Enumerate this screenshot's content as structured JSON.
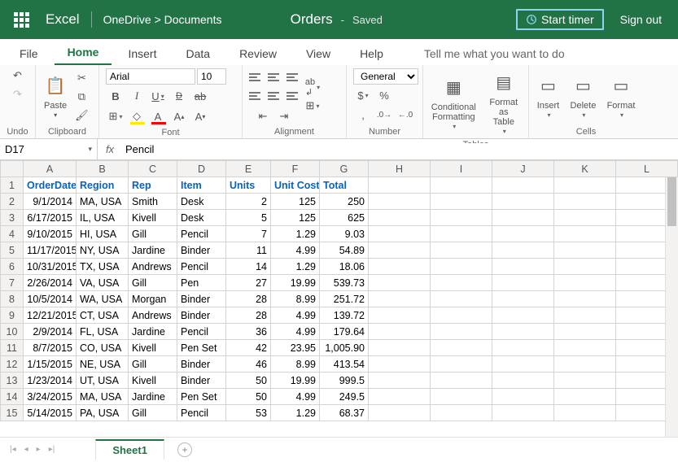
{
  "header": {
    "app": "Excel",
    "path": "OneDrive > Documents",
    "doc": "Orders",
    "status_sep": "-",
    "status": "Saved",
    "start_timer": "Start timer",
    "sign_out": "Sign out"
  },
  "tabs": {
    "file": "File",
    "home": "Home",
    "insert": "Insert",
    "data": "Data",
    "review": "Review",
    "view": "View",
    "help": "Help",
    "tell_me": "Tell me what you want to do"
  },
  "ribbon": {
    "undo_label": "Undo",
    "clipboard_label": "Clipboard",
    "paste": "Paste",
    "font_label": "Font",
    "font_name": "Arial",
    "font_size": "10",
    "alignment_label": "Alignment",
    "number_label": "Number",
    "number_format": "General",
    "currency": "$",
    "percent": "%",
    "comma": ",",
    "tables_label": "Tables",
    "conditional": "Conditional\nFormatting",
    "format_table": "Format\nas Table",
    "cells_label": "Cells",
    "insert": "Insert",
    "delete": "Delete",
    "format": "Format"
  },
  "fbar": {
    "cell": "D17",
    "formula": "Pencil"
  },
  "grid": {
    "columns": [
      "A",
      "B",
      "C",
      "D",
      "E",
      "F",
      "G",
      "H",
      "I",
      "J",
      "K",
      "L"
    ],
    "active_col": "D",
    "active_row": 17,
    "header": [
      "OrderDate",
      "Region",
      "Rep",
      "Item",
      "Units",
      "Unit Cost",
      "Total"
    ],
    "rows": [
      {
        "n": 2,
        "c": [
          "9/1/2014",
          "MA, USA",
          "Smith",
          "Desk",
          "2",
          "125",
          "250"
        ]
      },
      {
        "n": 3,
        "c": [
          "6/17/2015",
          "IL, USA",
          "Kivell",
          "Desk",
          "5",
          "125",
          "625"
        ]
      },
      {
        "n": 4,
        "c": [
          "9/10/2015",
          "HI, USA",
          "Gill",
          "Pencil",
          "7",
          "1.29",
          "9.03"
        ]
      },
      {
        "n": 5,
        "c": [
          "11/17/2015",
          "NY, USA",
          "Jardine",
          "Binder",
          "11",
          "4.99",
          "54.89"
        ]
      },
      {
        "n": 6,
        "c": [
          "10/31/2015",
          "TX, USA",
          "Andrews",
          "Pencil",
          "14",
          "1.29",
          "18.06"
        ]
      },
      {
        "n": 7,
        "c": [
          "2/26/2014",
          "VA, USA",
          "Gill",
          "Pen",
          "27",
          "19.99",
          "539.73"
        ]
      },
      {
        "n": 8,
        "c": [
          "10/5/2014",
          "WA, USA",
          "Morgan",
          "Binder",
          "28",
          "8.99",
          "251.72"
        ]
      },
      {
        "n": 9,
        "c": [
          "12/21/2015",
          "CT, USA",
          "Andrews",
          "Binder",
          "28",
          "4.99",
          "139.72"
        ]
      },
      {
        "n": 10,
        "c": [
          "2/9/2014",
          "FL, USA",
          "Jardine",
          "Pencil",
          "36",
          "4.99",
          "179.64"
        ]
      },
      {
        "n": 11,
        "c": [
          "8/7/2015",
          "CO, USA",
          "Kivell",
          "Pen Set",
          "42",
          "23.95",
          "1,005.90"
        ]
      },
      {
        "n": 12,
        "c": [
          "1/15/2015",
          "NE, USA",
          "Gill",
          "Binder",
          "46",
          "8.99",
          "413.54"
        ]
      },
      {
        "n": 13,
        "c": [
          "1/23/2014",
          "UT, USA",
          "Kivell",
          "Binder",
          "50",
          "19.99",
          "999.5"
        ]
      },
      {
        "n": 14,
        "c": [
          "3/24/2015",
          "MA, USA",
          "Jardine",
          "Pen Set",
          "50",
          "4.99",
          "249.5"
        ]
      },
      {
        "n": 15,
        "c": [
          "5/14/2015",
          "PA, USA",
          "Gill",
          "Pencil",
          "53",
          "1.29",
          "68.37"
        ]
      }
    ]
  },
  "bottom": {
    "sheet": "Sheet1"
  }
}
